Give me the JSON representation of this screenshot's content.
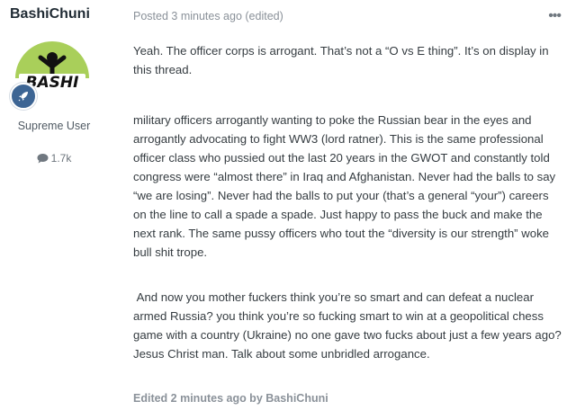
{
  "author": {
    "username": "BashiChuni",
    "avatar_icon": "bashi-avatar-logo",
    "avatar_text": "BASHI",
    "rank_icon": "rocket-icon",
    "title": "Supreme User",
    "post_count_icon": "comment-icon",
    "post_count": "1.7k"
  },
  "post": {
    "meta": "Posted 3 minutes ago (edited)",
    "more_icon": "more-options-icon",
    "paragraphs": [
      "Yeah. The officer corps is arrogant. That’s not a “O vs E thing”. It’s on display in this thread.",
      "military officers arrogantly wanting to poke the Russian bear in the eyes and arrogantly advocating to fight WW3 (lord ratner). This is the same professional officer class who pussied out the last 20 years in the GWOT and constantly told congress were “almost there” in Iraq and Afghanistan. Never had the balls to say “we are losing”. Never had the balls to put your (that’s a general “your”) careers on the line to call a spade a spade. Just happy to pass the buck and make the next rank. The same pussy officers who tout the “diversity is our strength” woke bull shit trope.",
      " And now you mother fuckers think you’re so smart and can defeat a nuclear armed Russia? you think you’re so fucking smart to win at a geopolitical chess game with a country (Ukraine) no one gave two fucks about just a few years ago? Jesus Christ man. Talk about some unbridled arrogance."
    ],
    "edited_note": "Edited 2 minutes ago by BashiChuni"
  },
  "colors": {
    "avatar_green": "#a9cf5a",
    "badge_blue": "#3d6594",
    "meta_gray": "#8a9199"
  }
}
